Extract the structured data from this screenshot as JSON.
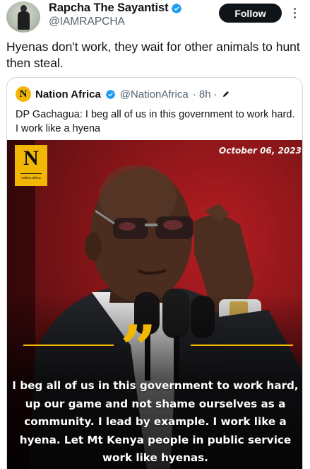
{
  "author": {
    "name": "Rapcha The Sayantist",
    "handle": "@IAMRAPCHA",
    "verified_color": "#1d9bf0"
  },
  "follow_label": "Follow",
  "tweet_text": "Hyenas don't work, they wait for other animals to hunt then steal.",
  "quoted": {
    "logo_letter": "N",
    "name": "Nation Africa",
    "handle": "@NationAfrica",
    "meta": "· 8h ·",
    "text": "DP Gachagua: I beg all of us in this government to work hard. I work like a hyena",
    "image": {
      "badge_letter": "N",
      "badge_caption": "nation.africa",
      "date": "October 06, 2023",
      "quote_text": "I beg all of us in this government to work hard, up our game and not shame ourselves as a community. I lead by example. I work like a hyena. Let Mt Kenya people in public service work like hyenas."
    }
  },
  "colors": {
    "brand_yellow": "#f2b705",
    "background_red": "#b51d22",
    "follow_bg": "#0f1419"
  }
}
